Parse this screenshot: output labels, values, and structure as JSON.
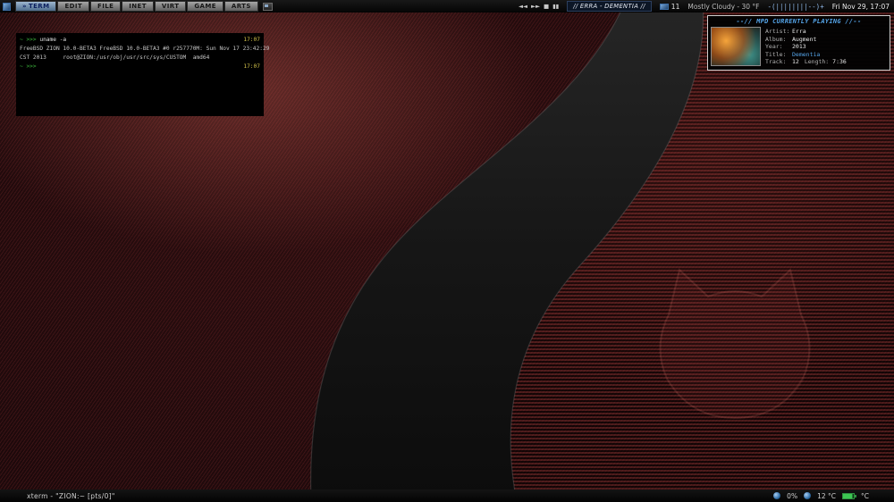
{
  "topbar": {
    "tabs": [
      "TERM",
      "EDIT",
      "FILE",
      "INET",
      "VIRT",
      "GAME",
      "ARTS"
    ],
    "active_tab_marker": "»",
    "media": {
      "rewind": "◄◄",
      "forward": "►►",
      "stop": "■",
      "pause": "▮▮"
    },
    "now_playing_ticker": "// ERRA - DEMENTIA //",
    "mail_count": "11",
    "weather": "Mostly Cloudy - 30 °F",
    "volume_indicator": "-(||||||||--)+",
    "clock": "Fri Nov 29, 17:07"
  },
  "mpd": {
    "header": "--// MPD CURRENTLY PLAYING //--",
    "artist_label": "Artist:",
    "artist_value": "Erra",
    "album_label": "Album:",
    "album_value": "Augment",
    "year_label": "Year:",
    "year_value": "2013",
    "title_label": "Title:",
    "title_value": "Dementia",
    "track_label": "Track:",
    "track_value": "12",
    "length_label": "Length:",
    "length_value": "7:36"
  },
  "terminal": {
    "line1_prompt": "~ >>> ",
    "line1_command": "uname -a",
    "line1_time": "17:07",
    "line2_output": "FreeBSD ZION 10.0-BETA3 FreeBSD 10.0-BETA3 #0 r257770M: Sun Nov 17 23:42:29",
    "line3_output": "CST 2013     root@ZION:/usr/obj/usr/src/sys/CUSTOM  amd64",
    "line4_prompt": "~ >>> ",
    "line4_time": "17:07"
  },
  "bottombar": {
    "window_title": "xterm - \"ZION:~  [pts/0]\"",
    "cpu_usage": "0%",
    "temperature": "12 °C",
    "battery_label": "°C"
  }
}
